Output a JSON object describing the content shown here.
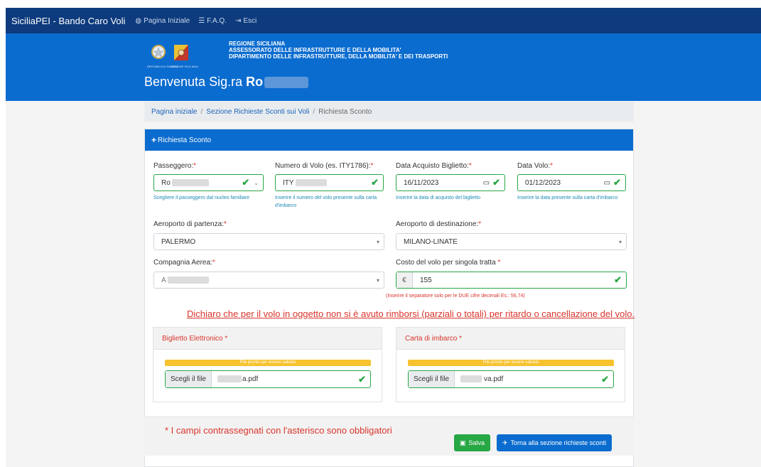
{
  "nav": {
    "brand": "SiciliaPEI - Bando Caro Voli",
    "home": "Pagina Iniziale",
    "faq": "F.A.Q.",
    "logout": "Esci"
  },
  "header": {
    "emblem_left_label": "REPUBBLICA ITALIANA",
    "emblem_right_label": "REGIONE SICILIANA",
    "line1": "REGIONE SICILIANA",
    "line2": "ASSESSORATO DELLE INFRASTRUTTURE E DELLA MOBILITA'",
    "line3": "DIPARTIMENTO DELLE INFRASTRUTTURE, DELLA MOBILITA' E DEI TRASPORTI",
    "welcome": "Benvenuta Sig.ra",
    "welcome_name": "Ro"
  },
  "breadcrumb": {
    "item1": "Pagina iniziale",
    "item2": "Sezione Richieste Sconti sui Voli",
    "sep": "/",
    "current": "Richiesta Sconto"
  },
  "form": {
    "title": "Richiesta Sconto",
    "required_mark": "*",
    "passenger": {
      "label": "Passeggero:",
      "value": "Ro",
      "help": "Scegliere il passeggero dal nucleo familiare"
    },
    "flight_number": {
      "label": "Numero di Volo (es. ITY1786):",
      "value": "ITY",
      "help": "Inserire il numero del volo presente sulla carta d'imbarco"
    },
    "purchase_date": {
      "label": "Data Acquisto Biglietto:",
      "value": "16/11/2023",
      "help": "Inserire la data di acquisto del biglietto"
    },
    "flight_date": {
      "label": "Data Volo:",
      "value": "01/12/2023",
      "help": "Inserire la data presente sulla carta d'imbarco"
    },
    "departure": {
      "label": "Aeroporto di partenza:",
      "value": "PALERMO"
    },
    "destination": {
      "label": "Aeroporto di destinazione:",
      "value": "MILANO-LINATE"
    },
    "airline": {
      "label": "Compagnia Aerea:",
      "value": "A"
    },
    "cost": {
      "label": "Costo del volo per singola tratta",
      "currency": "€",
      "value": "155",
      "note": "(Inserire il separatore solo per le DUE cifre decimali Es.: 56,74)"
    },
    "declaration": "Dichiaro che per il volo in oggetto non si è avuto rimborsi (parziali o totali) per ritardo o cancellazione del volo.",
    "ticket": {
      "title": "Biglietto Elettronico",
      "status": "File pronto per essere salvato",
      "choose": "Scegli il file",
      "filename": "a.pdf"
    },
    "boarding": {
      "title": "Carta di imbarco",
      "status": "File pronto per essere salvato",
      "choose": "Scegli il file",
      "filename": "va.pdf"
    },
    "mandatory_note": "* I campi contrassegnati con l'asterisco sono obbligatori",
    "save": "Salva",
    "back": "Torna alla sezione richieste sconti"
  },
  "colors": {
    "nav": "#0d3b7d",
    "banner": "#0b6ccf",
    "valid": "#28a745",
    "error": "#d9342b",
    "warning": "#f6c22e"
  }
}
